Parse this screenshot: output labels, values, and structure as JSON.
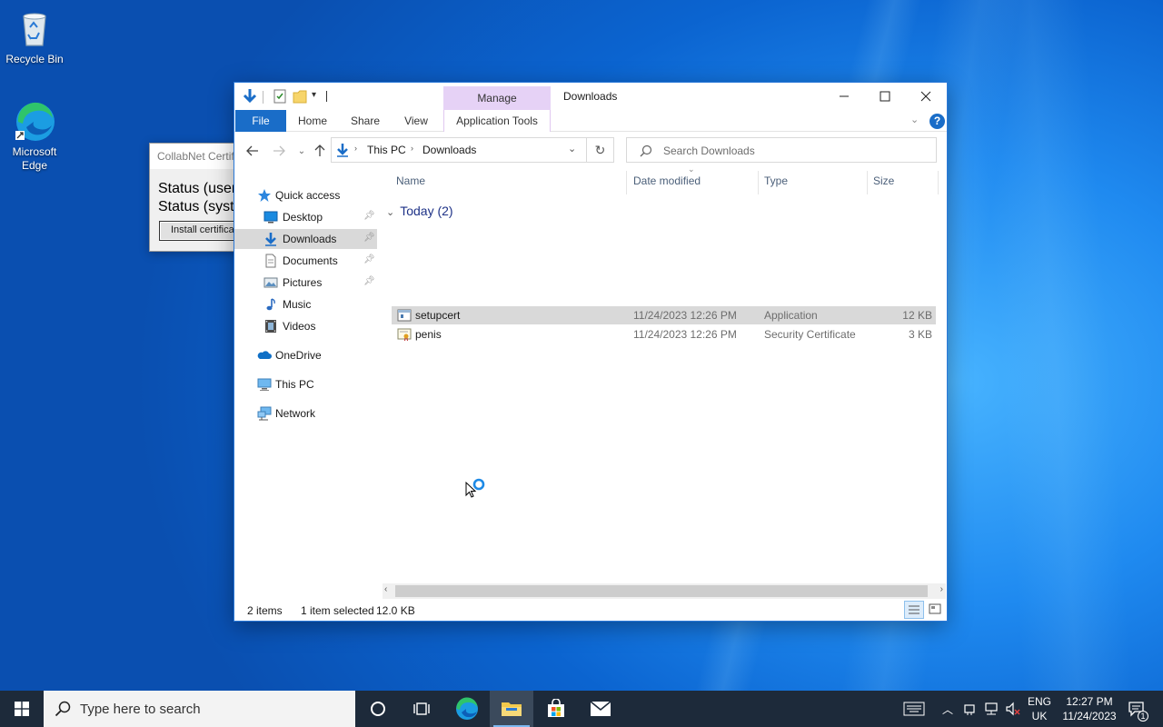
{
  "desktop": {
    "icons": [
      {
        "label": "Recycle Bin"
      },
      {
        "label": "Microsoft Edge"
      }
    ]
  },
  "collab_dialog": {
    "title": "CollabNet Certificate",
    "line1": "Status (user",
    "line2": "Status (system",
    "button": "Install certificate"
  },
  "explorer": {
    "manage_tab": "Manage",
    "title": "Downloads",
    "ribbon_tabs": [
      "File",
      "Home",
      "Share",
      "View",
      "Application Tools"
    ],
    "breadcrumb": [
      "This PC",
      "Downloads"
    ],
    "search_placeholder": "Search Downloads",
    "nav": {
      "quick_access": "Quick access",
      "items": [
        "Desktop",
        "Downloads",
        "Documents",
        "Pictures",
        "Music",
        "Videos"
      ],
      "onedrive": "OneDrive",
      "this_pc": "This PC",
      "network": "Network"
    },
    "columns": [
      "Name",
      "Date modified",
      "Type",
      "Size"
    ],
    "group": "Today (2)",
    "files": [
      {
        "name": "setupcert",
        "date": "11/24/2023 12:26 PM",
        "type": "Application",
        "size": "12 KB"
      },
      {
        "name": "penis",
        "date": "11/24/2023 12:26 PM",
        "type": "Security Certificate",
        "size": "3 KB"
      }
    ],
    "status": {
      "count": "2 items",
      "selection": "1 item selected",
      "size": "12.0 KB"
    }
  },
  "taskbar": {
    "search_placeholder": "Type here to search",
    "lang1": "ENG",
    "lang2": "UK",
    "time": "12:27 PM",
    "date": "11/24/2023",
    "notification_count": "1"
  },
  "colors": {
    "accent": "#1a6dc8",
    "manage_tab": "#e6d2f6",
    "selection": "#d9d9d9",
    "taskbar": "#1d2a3a"
  }
}
